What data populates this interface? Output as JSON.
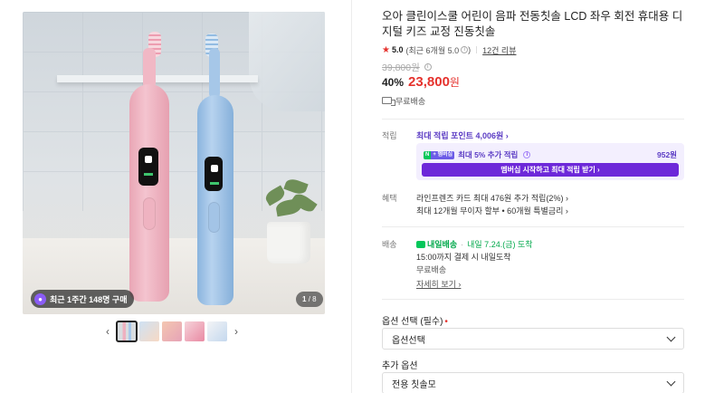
{
  "gallery": {
    "recent_badge": "최근 1주간 148명 구매",
    "page_current": "1",
    "page_total": "/ 8",
    "thumbnail_count": 5,
    "prev_label": "‹",
    "next_label": "›"
  },
  "product": {
    "title": "오아 클린이스쿨 어린이 음파 전동칫솔 LCD 좌우 회전 휴대용 디지털 키즈 교정 진동칫솔",
    "rating_star": "★",
    "rating_score": "5.0",
    "rating_recent": "(최근 6개월 5.0",
    "rating_recent_close": ")",
    "review_count": "12건 리뷰",
    "original_price": "39,800원",
    "discount_rate": "40%",
    "sale_price": "23,800",
    "sale_currency": "원",
    "shipping": "무료배송"
  },
  "reward": {
    "label": "적립",
    "max_points": "최대 적립 포인트 4,006원 ›",
    "membership_n": "N",
    "membership_plus": "+ 멤버십",
    "membership_text": "최대 5% 추가 적립",
    "membership_amount": "952원",
    "membership_button": "멤버십 시작하고 최대 적립 받기 ›"
  },
  "benefit": {
    "label": "혜택",
    "line1": "라인프렌즈 카드 최대 476원 추가 적립(2%) ›",
    "line2": "최대 12개월 무이자 할부 • 60개월 특별금리 ›"
  },
  "delivery": {
    "label": "배송",
    "fast_label": "내일배송",
    "sep": "·",
    "date": "내일 7.24.(금) 도착",
    "deadline": "15:00까지 결제 시 내일도착",
    "fee": "무료배송",
    "more": "자세히 보기 ›"
  },
  "options": {
    "required_label": "옵션 선택 (필수)",
    "required_marker": "•",
    "required_placeholder": "옵션선택",
    "additional_label": "추가 옵션",
    "additional_value": "전용 칫솔모"
  },
  "colors": {
    "accent_red": "#e5322d",
    "membership_purple": "#6d28d9",
    "delivery_green": "#03a94c"
  }
}
